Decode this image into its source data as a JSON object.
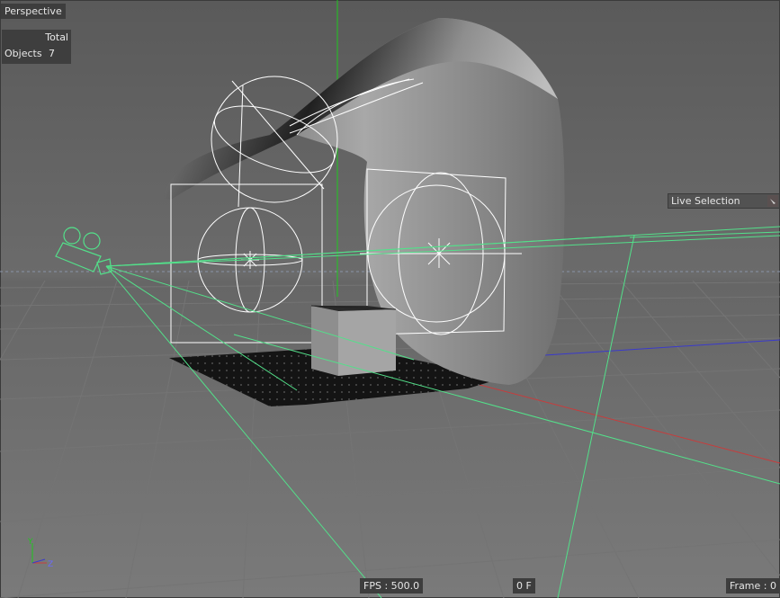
{
  "viewport": {
    "name": "Perspective"
  },
  "stats": {
    "header": "Total",
    "objects_label": "Objects",
    "objects_count": "7"
  },
  "tool": {
    "live_selection": "Live Selection"
  },
  "status": {
    "fps": "FPS : 500.0",
    "frame_offset": "0 F",
    "frame": "Frame : 0"
  },
  "axis_gizmo": {
    "y": "Y",
    "z": "Z"
  },
  "colors": {
    "viewport_bg": "#5f5f5f",
    "grid_line": "#707070",
    "camera_green": "#53e08a",
    "axis_red": "#c83c3c",
    "axis_blue": "#3a3acc",
    "axis_green": "#1ec81e",
    "wireframe": "#ffffff"
  },
  "icons": [
    "camera-icon",
    "dropdown-arrow-icon",
    "axis-gizmo-icon"
  ]
}
